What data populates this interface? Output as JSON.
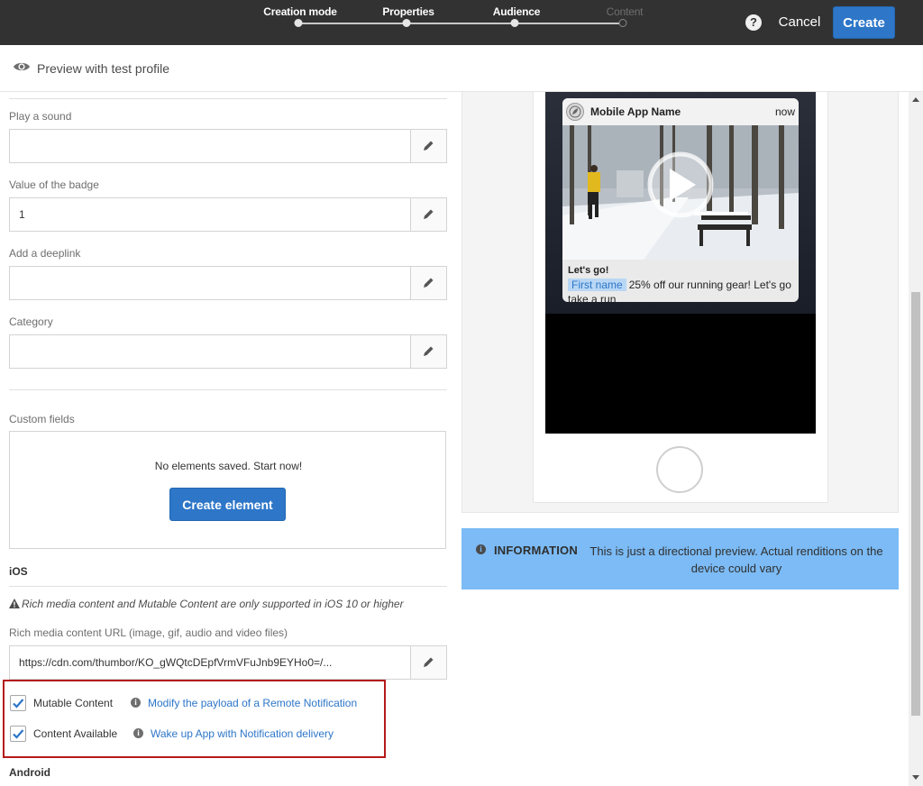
{
  "header": {
    "steps": [
      {
        "label": "Creation mode",
        "state": "completed"
      },
      {
        "label": "Properties",
        "state": "completed"
      },
      {
        "label": "Audience",
        "state": "completed"
      },
      {
        "label": "Content",
        "state": "current"
      }
    ],
    "help_label": "?",
    "cancel_label": "Cancel",
    "create_label": "Create"
  },
  "preview_bar": {
    "label": "Preview with test profile",
    "icon": "eye-icon"
  },
  "form": {
    "play_sound": {
      "label": "Play a sound",
      "value": ""
    },
    "badge": {
      "label": "Value of the badge",
      "value": "1"
    },
    "deeplink": {
      "label": "Add a deeplink",
      "value": ""
    },
    "category": {
      "label": "Category",
      "value": ""
    },
    "custom_fields": {
      "label": "Custom fields",
      "empty_text": "No elements saved. Start now!",
      "create_button": "Create element"
    },
    "ios": {
      "title": "iOS",
      "warning": "Rich media content and Mutable Content are only supported in iOS 10 or higher",
      "rich_media": {
        "label": "Rich media content URL (image, gif, audio and video files)",
        "value": "https://cdn.com/thumbor/KO_gWQtcDEpfVrmVFuJnb9EYHo0=/..."
      },
      "mutable_content": {
        "label": "Mutable Content",
        "checked": true,
        "link": "Modify the payload of a Remote Notification"
      },
      "content_available": {
        "label": "Content Available",
        "checked": true,
        "link": "Wake up App with Notification delivery"
      }
    },
    "android": {
      "title": "Android"
    }
  },
  "preview": {
    "notification": {
      "app_name": "Mobile App Name",
      "time": "now",
      "title": "Let's go!",
      "personalization_field": "First name",
      "body": "25% off our running gear! Let's go take a run"
    },
    "info": {
      "title": "INFORMATION",
      "text": "This is just a directional preview. Actual renditions on the device could vary"
    }
  },
  "colors": {
    "topbar": "#323232",
    "primary_button": "#2d76c8",
    "info_box": "#7cbbf5",
    "highlight_border": "#b41a1a"
  }
}
